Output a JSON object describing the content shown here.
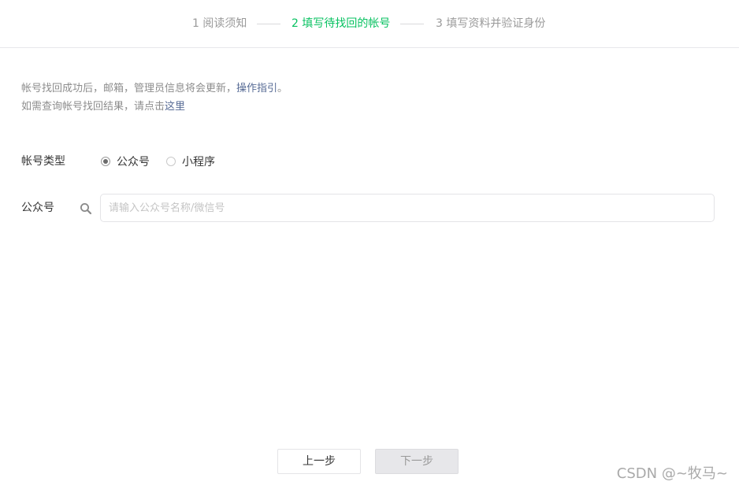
{
  "steps": [
    {
      "label": "1 阅读须知",
      "active": false
    },
    {
      "label": "2 填写待找回的帐号",
      "active": true
    },
    {
      "label": "3 填写资料并验证身份",
      "active": false
    }
  ],
  "notice": {
    "line1_text": "帐号找回成功后，邮箱，管理员信息将会更新，",
    "line1_link": "操作指引",
    "line1_end": "。",
    "line2_text": "如需查询帐号找回结果，请点击",
    "line2_link": "这里"
  },
  "account_type": {
    "label": "帐号类型",
    "options": [
      {
        "label": "公众号",
        "checked": true
      },
      {
        "label": "小程序",
        "checked": false
      }
    ]
  },
  "account_field": {
    "label": "公众号",
    "placeholder": "请输入公众号名称/微信号",
    "value": "",
    "icon": "search-icon"
  },
  "buttons": {
    "prev": "上一步",
    "next": "下一步",
    "next_disabled": true
  },
  "watermark": "CSDN @~牧马~",
  "colors": {
    "active_step": "#07c160",
    "link": "#576b95",
    "muted": "#9a9a9a"
  }
}
